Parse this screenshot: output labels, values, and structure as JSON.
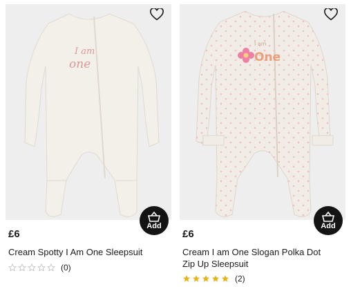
{
  "products": [
    {
      "price": "£6",
      "title": "Cream Spotty I Am One Sleepsuit",
      "rating_count": "(0)",
      "stars_filled": 0,
      "stars_total": 5,
      "add_label": "Add",
      "image_text_line1": "I am",
      "image_text_line2": "one",
      "garment_color": "#f3efe9"
    },
    {
      "price": "£6",
      "title": "Cream I am One Slogan Polka Dot Zip Up Sleepsuit",
      "rating_count": "(2)",
      "stars_filled": 5,
      "stars_total": 5,
      "add_label": "Add",
      "image_text_line1": "I am",
      "image_text_line2": "One",
      "garment_color": "#f1ece6"
    }
  ],
  "colors": {
    "star_filled": "#e6b417",
    "star_empty": "#bdbdbd",
    "button_bg": "#141414",
    "image_bg": "#eeeeee",
    "accent_flower": "#ee7fa5"
  },
  "icons": {
    "favourite": "heart-outline-icon",
    "add_to_basket": "basket-icon",
    "rating": "star-icon"
  }
}
